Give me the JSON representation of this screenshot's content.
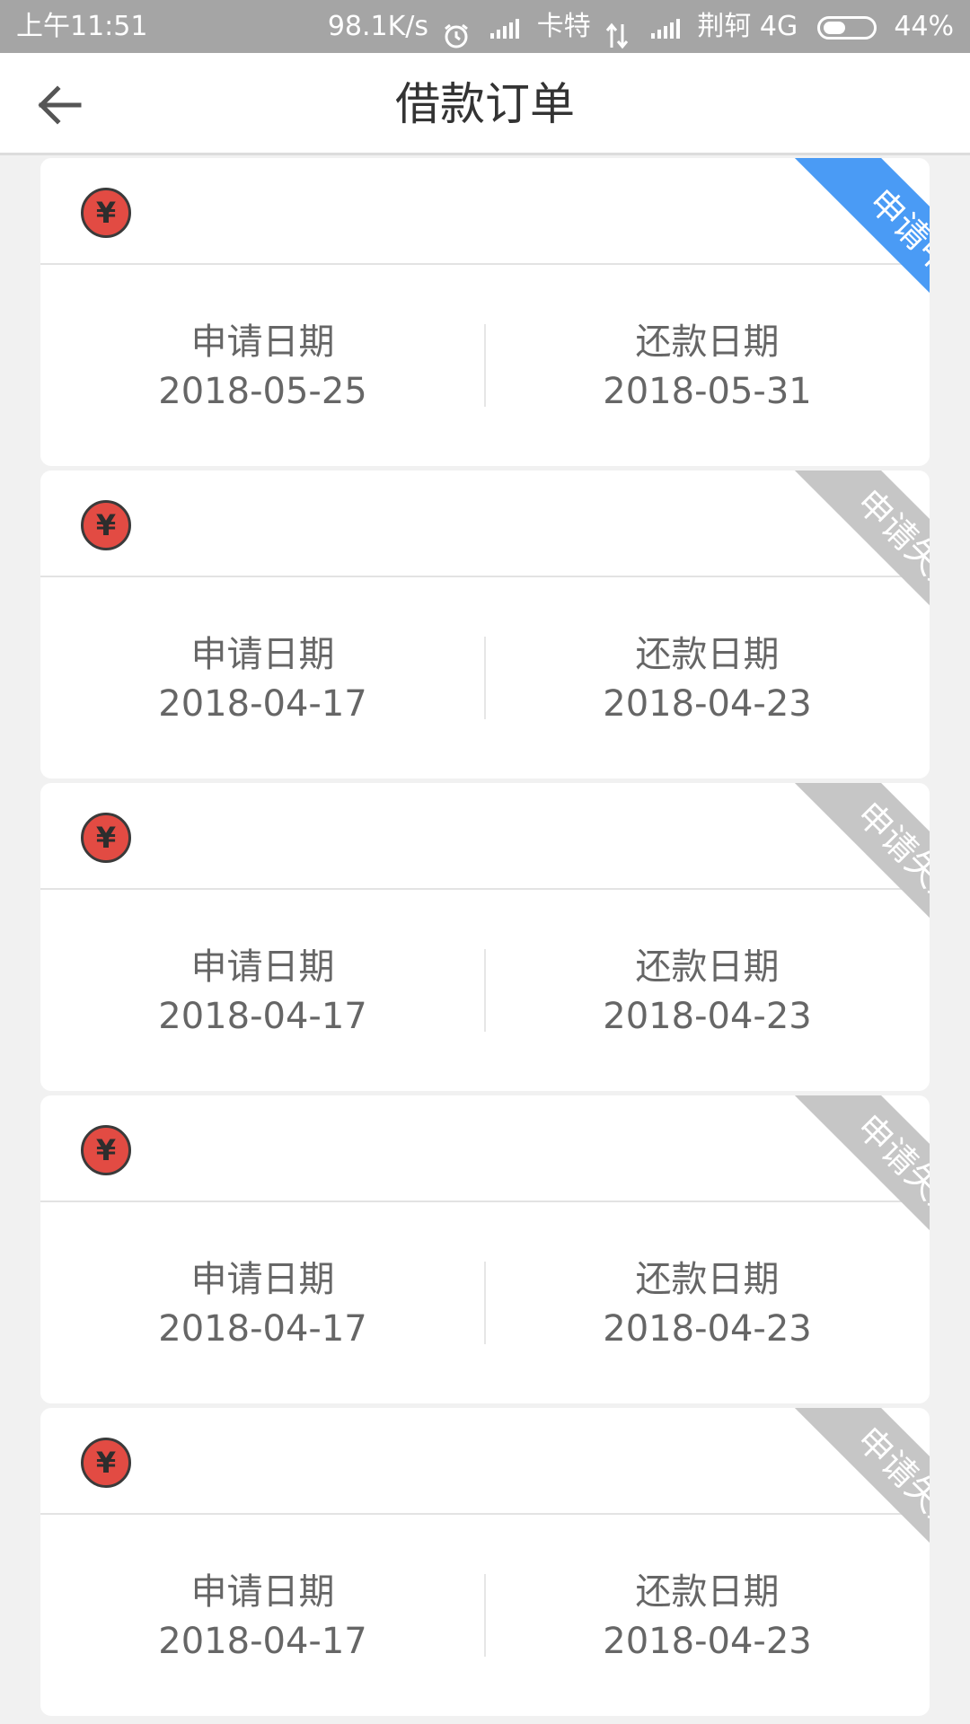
{
  "status_bar": {
    "time": "上午11:51",
    "net_speed": "98.1K/s",
    "carrier1": "卡特",
    "carrier2": "荆轲",
    "network": "4G",
    "battery": "44%",
    "battery_level": 0.44
  },
  "header": {
    "title": "借款订单"
  },
  "orders": [
    {
      "status": "申请中",
      "status_color": "#4a9bf5",
      "apply_label": "申请日期",
      "apply_date": "2018-05-25",
      "repay_label": "还款日期",
      "repay_date": "2018-05-31",
      "coin": "¥"
    },
    {
      "status": "申请失败",
      "status_color": "#c6c6c6",
      "apply_label": "申请日期",
      "apply_date": "2018-04-17",
      "repay_label": "还款日期",
      "repay_date": "2018-04-23",
      "coin": "¥"
    },
    {
      "status": "申请失败",
      "status_color": "#c6c6c6",
      "apply_label": "申请日期",
      "apply_date": "2018-04-17",
      "repay_label": "还款日期",
      "repay_date": "2018-04-23",
      "coin": "¥"
    },
    {
      "status": "申请失败",
      "status_color": "#c6c6c6",
      "apply_label": "申请日期",
      "apply_date": "2018-04-17",
      "repay_label": "还款日期",
      "repay_date": "2018-04-23",
      "coin": "¥"
    },
    {
      "status": "申请失败",
      "status_color": "#c6c6c6",
      "apply_label": "申请日期",
      "apply_date": "2018-04-17",
      "repay_label": "还款日期",
      "repay_date": "2018-04-23",
      "coin": "¥"
    }
  ]
}
